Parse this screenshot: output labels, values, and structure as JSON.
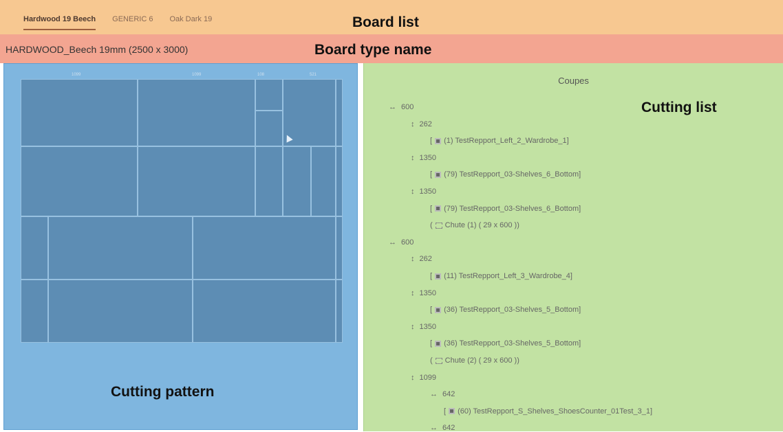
{
  "board_list": {
    "tabs": [
      "Hardwood 19 Beech",
      "GENERIC 6",
      "Oak Dark 19"
    ],
    "active_index": 0,
    "label": "Board list"
  },
  "board_type": {
    "name": "HARDWOOD_Beech 19mm (2500 x 3000)",
    "label": "Board type name"
  },
  "cutting_pattern": {
    "label": "Cutting pattern",
    "top_dims": [
      "1099",
      "1099",
      "108",
      "521"
    ]
  },
  "cutting_list": {
    "title": "Coupes",
    "label": "Cutting list",
    "rows": [
      {
        "indent": 0,
        "type": "h",
        "text": "600"
      },
      {
        "indent": 1,
        "type": "v",
        "text": "262"
      },
      {
        "indent": 2,
        "type": "part",
        "text": "(1) TestRepport_Left_2_Wardrobe_1"
      },
      {
        "indent": 1,
        "type": "v",
        "text": "1350"
      },
      {
        "indent": 2,
        "type": "part",
        "text": "(79) TestRepport_03-Shelves_6_Bottom"
      },
      {
        "indent": 1,
        "type": "v",
        "text": "1350"
      },
      {
        "indent": 2,
        "type": "part",
        "text": "(79) TestRepport_03-Shelves_6_Bottom"
      },
      {
        "indent": 2,
        "type": "chute",
        "text": "Chute  (1) ( 29 x 600 )"
      },
      {
        "indent": 0,
        "type": "h",
        "text": "600"
      },
      {
        "indent": 1,
        "type": "v",
        "text": "262"
      },
      {
        "indent": 2,
        "type": "part",
        "text": "(11) TestRepport_Left_3_Wardrobe_4"
      },
      {
        "indent": 1,
        "type": "v",
        "text": "1350"
      },
      {
        "indent": 2,
        "type": "part",
        "text": "(36) TestRepport_03-Shelves_5_Bottom"
      },
      {
        "indent": 1,
        "type": "v",
        "text": "1350"
      },
      {
        "indent": 2,
        "type": "part",
        "text": "(36) TestRepport_03-Shelves_5_Bottom"
      },
      {
        "indent": 2,
        "type": "chute",
        "text": "Chute  (2) ( 29 x 600 )"
      },
      {
        "indent": 1,
        "type": "v",
        "text": "1099"
      },
      {
        "indent": 2,
        "type": "h",
        "text": "642"
      },
      {
        "indent": 3,
        "type": "part",
        "text": "(60) TestRepport_S_Shelves_ShoesCounter_01Test_3_1"
      },
      {
        "indent": 2,
        "type": "h",
        "text": "642"
      }
    ]
  }
}
